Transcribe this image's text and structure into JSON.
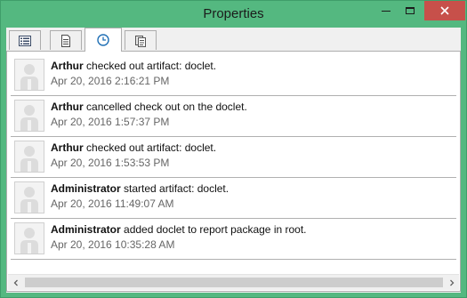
{
  "window": {
    "title": "Properties"
  },
  "tabs": [
    {
      "icon": "list-icon",
      "active": false
    },
    {
      "icon": "document-icon",
      "active": false
    },
    {
      "icon": "clock-icon",
      "active": true
    },
    {
      "icon": "clipboard-icon",
      "active": false
    }
  ],
  "entries": [
    {
      "user": "Arthur",
      "action": "checked out artifact: doclet.",
      "timestamp": "Apr 20, 2016 2:16:21 PM"
    },
    {
      "user": "Arthur",
      "action": "cancelled check out on the doclet.",
      "timestamp": "Apr 20, 2016 1:57:37 PM"
    },
    {
      "user": "Arthur",
      "action": "checked out artifact: doclet.",
      "timestamp": "Apr 20, 2016 1:53:53 PM"
    },
    {
      "user": "Administrator",
      "action": "started artifact: doclet.",
      "timestamp": "Apr 20, 2016 11:49:07 AM"
    },
    {
      "user": "Administrator",
      "action": "added doclet to report package in root.",
      "timestamp": "Apr 20, 2016 10:35:28 AM"
    }
  ],
  "colors": {
    "titlebar": "#54b880",
    "close_button": "#c7504a"
  }
}
